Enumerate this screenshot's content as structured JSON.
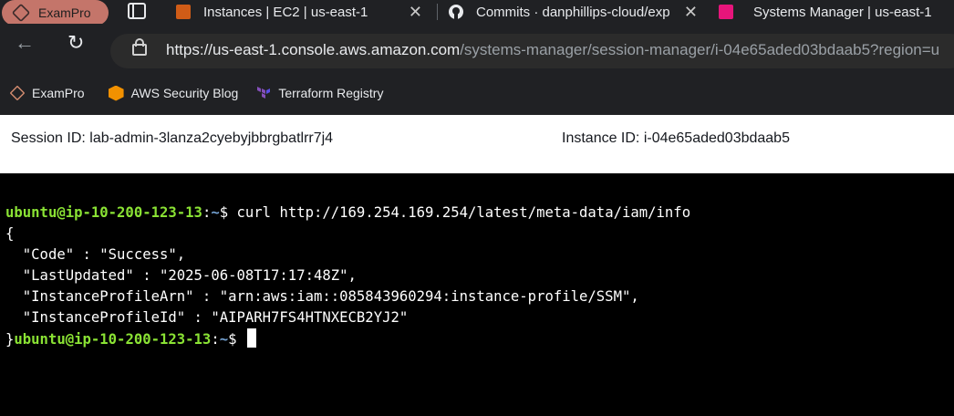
{
  "browser": {
    "profile_label": "ExamPro",
    "tabs": [
      {
        "title": "Instances | EC2 | us-east-1",
        "favicon": "aws-ec2-icon"
      },
      {
        "title": "Commits · danphillips-cloud/exp",
        "favicon": "github-icon"
      },
      {
        "title": "Systems Manager | us-east-1",
        "favicon": "aws-ssm-icon"
      }
    ],
    "url_host": "https://us-east-1.console.aws.amazon.com",
    "url_path": "/systems-manager/session-manager/i-04e65aded03bdaab5?region=u",
    "bookmarks": [
      {
        "label": "ExamPro",
        "icon": "exampro-icon"
      },
      {
        "label": "AWS Security Blog",
        "icon": "aws-icon"
      },
      {
        "label": "Terraform Registry",
        "icon": "terraform-icon"
      }
    ],
    "colors": {
      "chrome_bg": "#202124",
      "profile_bg": "#c4756a",
      "prompt_user": "#8ae234",
      "prompt_path": "#729fcf"
    }
  },
  "session": {
    "session_id": "Session ID: lab-admin-3lanza2cyebyjbbrgbatlrr7j4",
    "instance_id": "Instance ID: i-04e65aded03bdaab5"
  },
  "terminal": {
    "prompt_user": "ubuntu@ip-10-200-123-13",
    "prompt_colon": ":",
    "prompt_path": "~",
    "prompt_symbol": "$ ",
    "command": "curl http://169.254.169.254/latest/meta-data/iam/info",
    "output": [
      "{",
      "  \"Code\" : \"Success\",",
      "  \"LastUpdated\" : \"2025-06-08T17:17:48Z\",",
      "  \"InstanceProfileArn\" : \"arn:aws:iam::085843960294:instance-profile/SSM\",",
      "  \"InstanceProfileId\" : \"AIPARH7FS4HTNXECB2YJ2\""
    ],
    "closing_brace": "}"
  }
}
